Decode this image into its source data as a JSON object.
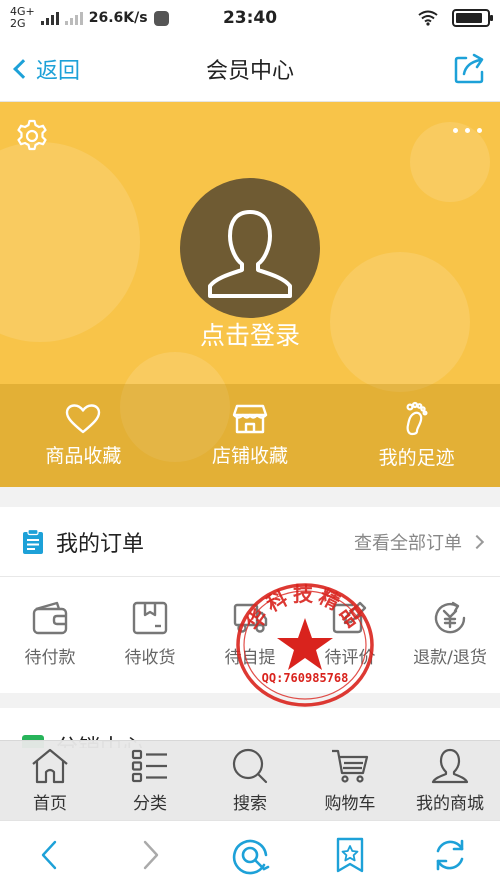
{
  "status_bar": {
    "network_top": "4G+",
    "network_bottom": "2G",
    "speed": "26.6K/s",
    "time": "23:40",
    "battery_level": 0.85
  },
  "nav": {
    "back_label": "返回",
    "title": "会员中心"
  },
  "profile": {
    "login_label": "点击登录",
    "favorites": [
      {
        "label": "商品收藏",
        "icon": "heart-icon"
      },
      {
        "label": "店铺收藏",
        "icon": "store-icon"
      },
      {
        "label": "我的足迹",
        "icon": "footprint-icon"
      }
    ]
  },
  "orders": {
    "title": "我的订单",
    "view_all": "查看全部订单",
    "items": [
      {
        "label": "待付款",
        "icon": "wallet-icon"
      },
      {
        "label": "待收货",
        "icon": "package-icon"
      },
      {
        "label": "待自提",
        "icon": "pickup-icon"
      },
      {
        "label": "待评价",
        "icon": "review-icon"
      },
      {
        "label": "退款/退货",
        "icon": "refund-icon"
      }
    ]
  },
  "distribution": {
    "title": "分销中心"
  },
  "tabbar": [
    {
      "label": "首页",
      "icon": "home-icon"
    },
    {
      "label": "分类",
      "icon": "list-icon"
    },
    {
      "label": "搜索",
      "icon": "search-icon"
    },
    {
      "label": "购物车",
      "icon": "cart-icon"
    },
    {
      "label": "我的商城",
      "icon": "user-icon"
    }
  ],
  "stamp": {
    "top_text": "华科技精品",
    "bottom_text": "QQ:760985768"
  },
  "colors": {
    "accent": "#1da1d8",
    "hero": "#f8c449",
    "avatar_bg": "#6f5b33",
    "stamp_red": "#d9231d",
    "dist_green": "#27b45a"
  }
}
